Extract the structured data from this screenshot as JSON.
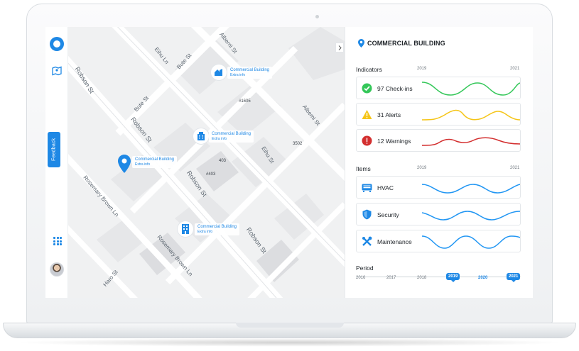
{
  "app": {
    "feedback_label": "Feedback",
    "accent": "#1e88e5"
  },
  "map": {
    "streets": [
      "Alberni St",
      "Robson St",
      "Eihu Ln",
      "Bute St",
      "Robson St",
      "Bute St",
      "Albemi St",
      "Robson St",
      "Eihu St",
      "Rosemary Brown Ln",
      "Robson St",
      "Rosemary Brown Ln",
      "Haro St"
    ],
    "numbers": [
      "#1605",
      "3502",
      "403",
      "#403"
    ],
    "markers": [
      {
        "title": "Commercial Building",
        "sub": "Extra info",
        "icon": "home-building-icon"
      },
      {
        "title": "Commercial Building",
        "sub": "Extra info",
        "icon": "office-building-icon"
      },
      {
        "title": "Commercial Building",
        "sub": "Extra info",
        "icon": "location-pin-icon"
      },
      {
        "title": "Commercial Building",
        "sub": "Extra info",
        "icon": "tower-building-icon"
      }
    ]
  },
  "panel": {
    "title": "COMMERCIAL BUILDING",
    "indicators": {
      "label": "Indicators",
      "year_start": "2019",
      "year_end": "2021",
      "rows": [
        {
          "label": "97 Check-ins",
          "icon": "check-circle-icon",
          "color": "#34c759"
        },
        {
          "label": "31 Alerts",
          "icon": "warning-triangle-icon",
          "color": "#f5c518"
        },
        {
          "label": "12 Warnings",
          "icon": "error-circle-icon",
          "color": "#d32f2f"
        }
      ]
    },
    "items": {
      "label": "Items",
      "year_start": "2019",
      "year_end": "2021",
      "rows": [
        {
          "label": "HVAC",
          "icon": "hvac-icon",
          "color": "#2196f3"
        },
        {
          "label": "Security",
          "icon": "shield-icon",
          "color": "#2196f3"
        },
        {
          "label": "Maintenance",
          "icon": "tools-icon",
          "color": "#2196f3"
        }
      ]
    },
    "period": {
      "label": "Period",
      "years": [
        "2016",
        "2017",
        "2018",
        "2019",
        "2020",
        "2021"
      ],
      "selected_start": "2019",
      "selected_end": "2021"
    }
  }
}
